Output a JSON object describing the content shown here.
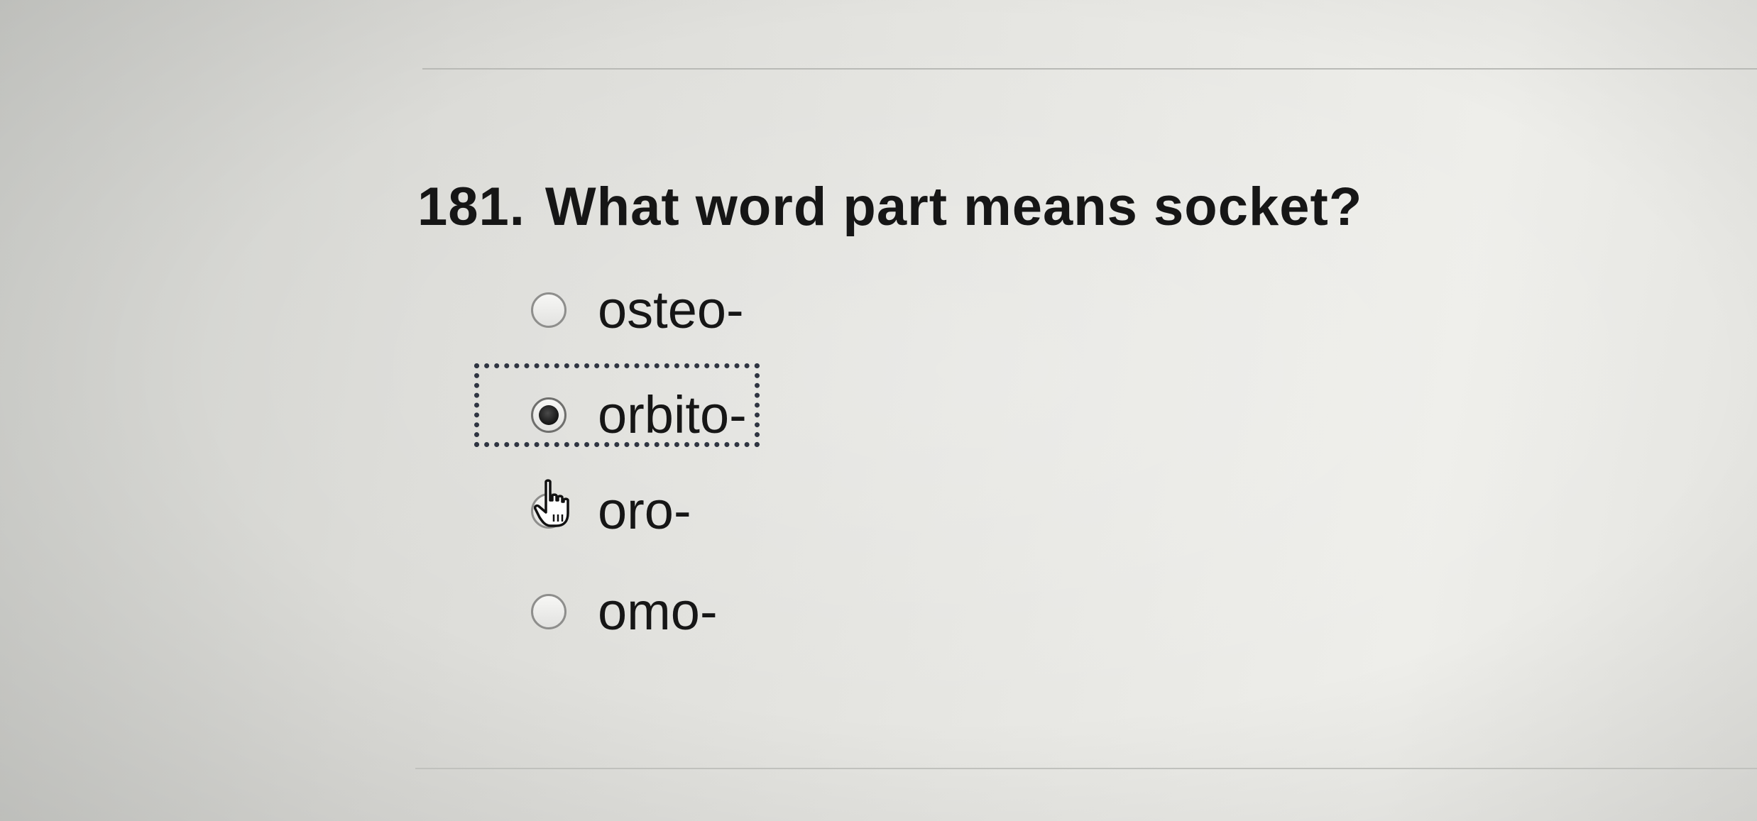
{
  "question": {
    "number": "181.",
    "text": "What word part means socket?"
  },
  "options": [
    {
      "label": "osteo-",
      "selected": false
    },
    {
      "label": "orbito-",
      "selected": true
    },
    {
      "label": "oro-",
      "selected": false
    },
    {
      "label": "omo-",
      "selected": false
    }
  ],
  "cursor": "pointing-hand-cursor"
}
